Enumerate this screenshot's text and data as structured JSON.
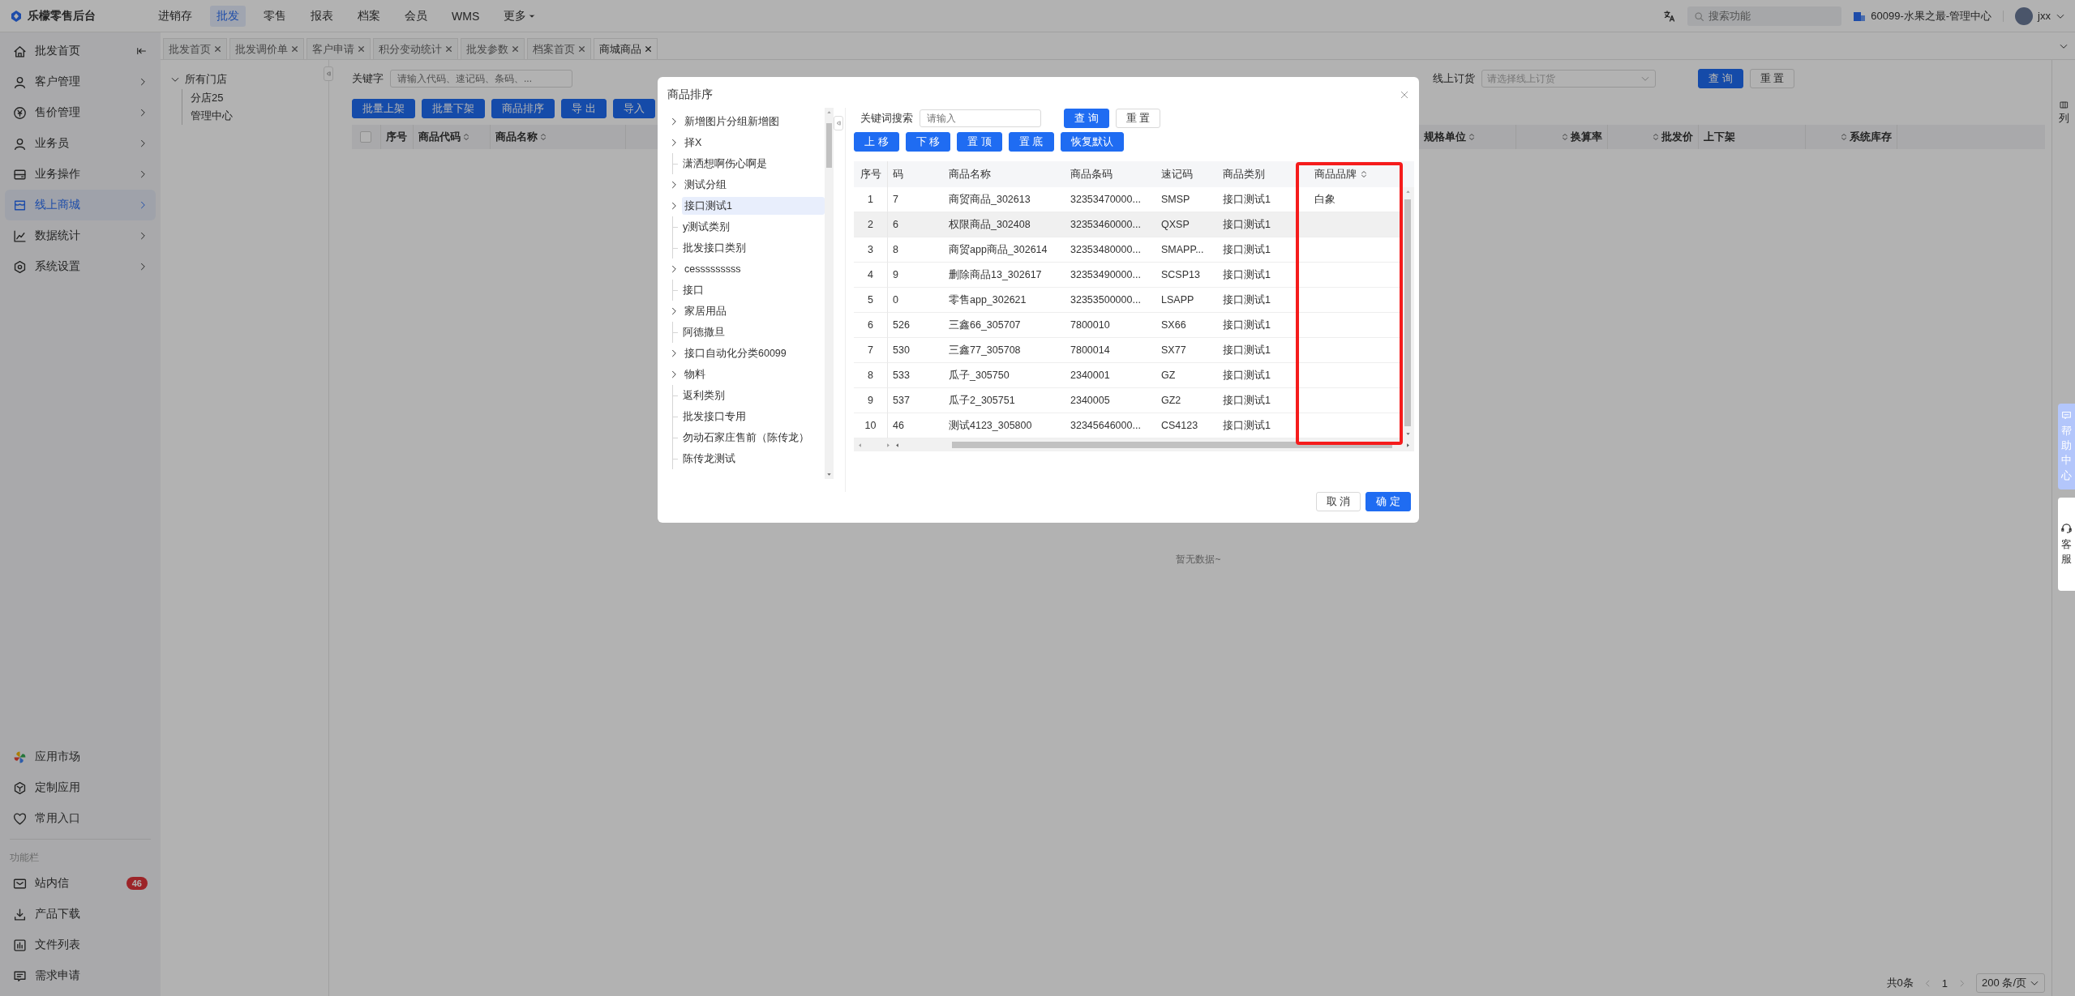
{
  "topbar": {
    "brand": "乐檬零售后台",
    "nav": [
      {
        "label": "进销存",
        "selected": false,
        "caret": false
      },
      {
        "label": "批发",
        "selected": true,
        "caret": false
      },
      {
        "label": "零售",
        "selected": false,
        "caret": false
      },
      {
        "label": "报表",
        "selected": false,
        "caret": false
      },
      {
        "label": "档案",
        "selected": false,
        "caret": false
      },
      {
        "label": "会员",
        "selected": false,
        "caret": false
      },
      {
        "label": "WMS",
        "selected": false,
        "caret": false
      },
      {
        "label": "更多",
        "selected": false,
        "caret": true
      }
    ],
    "search": {
      "placeholder": "搜索功能"
    },
    "store": "60099-水果之最-管理中心",
    "user": "jxx"
  },
  "sidebar": {
    "items": [
      {
        "label": "批发首页",
        "selected": false,
        "kind": "collapse"
      },
      {
        "label": "客户管理",
        "selected": false,
        "kind": "expand"
      },
      {
        "label": "售价管理",
        "selected": false,
        "kind": "expand"
      },
      {
        "label": "业务员",
        "selected": false,
        "kind": "expand"
      },
      {
        "label": "业务操作",
        "selected": false,
        "kind": "expand"
      },
      {
        "label": "线上商城",
        "selected": true,
        "kind": "expand"
      },
      {
        "label": "数据统计",
        "selected": false,
        "kind": "expand"
      },
      {
        "label": "系统设置",
        "selected": false,
        "kind": "expand"
      }
    ],
    "tools": [
      {
        "label": "应用市场"
      },
      {
        "label": "定制应用"
      },
      {
        "label": "常用入口"
      }
    ],
    "section": "功能栏",
    "functions": [
      {
        "label": "站内信",
        "badge": "46"
      },
      {
        "label": "产品下载"
      },
      {
        "label": "文件列表"
      },
      {
        "label": "需求申请"
      }
    ]
  },
  "tabs": [
    {
      "label": "批发首页",
      "selected": false
    },
    {
      "label": "批发调价单",
      "selected": false
    },
    {
      "label": "客户申请",
      "selected": false
    },
    {
      "label": "积分变动统计",
      "selected": false
    },
    {
      "label": "批发参数",
      "selected": false
    },
    {
      "label": "档案首页",
      "selected": false
    },
    {
      "label": "商城商品",
      "selected": true
    }
  ],
  "store_tree": {
    "label": "所有门店",
    "expanded": true,
    "children": [
      {
        "label": "分店25"
      },
      {
        "label": "管理中心"
      }
    ]
  },
  "filters": {
    "keyword": {
      "label": "关键字",
      "placeholder": "请输入代码、速记码、条码、..."
    },
    "order": {
      "label": "线上订货",
      "placeholder": "请选择线上订货"
    },
    "buttons": [
      {
        "label": "查 询",
        "kind": "primary"
      },
      {
        "label": "重 置",
        "kind": "default"
      }
    ]
  },
  "actions": [
    "批量上架",
    "批量下架",
    "商品排序",
    "导 出",
    "导入"
  ],
  "table": {
    "select_all_checked": false,
    "columns_left": [
      {
        "label": "序号",
        "sort_before": false,
        "sort_after": false
      },
      {
        "label": "商品代码",
        "sort_before": false,
        "sort_after": true
      },
      {
        "label": "商品名称",
        "sort_before": false,
        "sort_after": true
      }
    ],
    "columns_right": [
      {
        "label": "规格单位",
        "sort_before": false,
        "sort_after": true
      },
      {
        "label": "换算率",
        "sort_before": true,
        "sort_after": false
      },
      {
        "label": "批发价",
        "sort_before": true,
        "sort_after": false
      },
      {
        "label": "上下架",
        "sort_before": false,
        "sort_after": false
      },
      {
        "label": "系统库存",
        "sort_before": true,
        "sort_after": false
      }
    ],
    "column_settings": "列",
    "empty": "暂无数据~"
  },
  "pagination": {
    "total": "共0条",
    "page": "1",
    "page_size": "200 条/页"
  },
  "float_tabs": [
    {
      "label": "帮助中心",
      "kind": "help"
    },
    {
      "label": "客服",
      "kind": "service"
    }
  ],
  "dialog": {
    "title": "商品排序",
    "tree": [
      {
        "label": "新增图片分组新增图",
        "expandable": true,
        "selected": false
      },
      {
        "label": "择X",
        "expandable": true,
        "selected": false
      },
      {
        "label": "潇洒想啊伤心啊是",
        "expandable": false,
        "selected": false
      },
      {
        "label": "测试分组",
        "expandable": true,
        "selected": false
      },
      {
        "label": "接口测试1",
        "expandable": true,
        "selected": true
      },
      {
        "label": "y测试类别",
        "expandable": false,
        "selected": false
      },
      {
        "label": "批发接口类别",
        "expandable": false,
        "selected": false
      },
      {
        "label": "cesssssssss",
        "expandable": true,
        "selected": false
      },
      {
        "label": "接口",
        "expandable": false,
        "selected": false
      },
      {
        "label": "家居用品",
        "expandable": true,
        "selected": false
      },
      {
        "label": "阿德撒旦",
        "expandable": false,
        "selected": false
      },
      {
        "label": "接口自动化分类60099",
        "expandable": true,
        "selected": false
      },
      {
        "label": "物料",
        "expandable": true,
        "selected": false
      },
      {
        "label": "返利类别",
        "expandable": false,
        "selected": false
      },
      {
        "label": "批发接口专用",
        "expandable": false,
        "selected": false
      },
      {
        "label": "勿动石家庄售前（陈传龙）",
        "expandable": false,
        "selected": false
      },
      {
        "label": "陈传龙测试",
        "expandable": false,
        "selected": false
      }
    ],
    "search": {
      "label": "关键词搜索",
      "placeholder": "请输入"
    },
    "search_buttons": [
      {
        "label": "查 询",
        "kind": "primary"
      },
      {
        "label": "重 置",
        "kind": "default"
      }
    ],
    "move_buttons": [
      "上 移",
      "下 移",
      "置 顶",
      "置 底",
      "恢复默认"
    ],
    "columns": [
      {
        "label": "序号",
        "sort": false
      },
      {
        "label": "码",
        "sort": false
      },
      {
        "label": "商品名称",
        "sort": false
      },
      {
        "label": "商品条码",
        "sort": false
      },
      {
        "label": "速记码",
        "sort": false
      },
      {
        "label": "商品类别",
        "sort": false
      },
      {
        "label": "商品品牌",
        "sort": true
      }
    ],
    "rows": [
      {
        "highlighted": false,
        "cells": [
          "1",
          "7",
          "商贸商品_302613",
          "32353470000...",
          "SMSP",
          "接口测试1",
          "白象"
        ]
      },
      {
        "highlighted": true,
        "cells": [
          "2",
          "6",
          "权限商品_302408",
          "32353460000...",
          "QXSP",
          "接口测试1"
        ]
      },
      {
        "highlighted": false,
        "cells": [
          "3",
          "8",
          "商贸app商品_302614",
          "32353480000...",
          "SMAPP...",
          "接口测试1"
        ]
      },
      {
        "highlighted": false,
        "cells": [
          "4",
          "9",
          "删除商品13_302617",
          "32353490000...",
          "SCSP13",
          "接口测试1"
        ]
      },
      {
        "highlighted": false,
        "cells": [
          "5",
          "0",
          "零售app_302621",
          "32353500000...",
          "LSAPP",
          "接口测试1"
        ]
      },
      {
        "highlighted": false,
        "cells": [
          "6",
          "526",
          "三鑫66_305707",
          "7800010",
          "SX66",
          "接口测试1"
        ]
      },
      {
        "highlighted": false,
        "cells": [
          "7",
          "530",
          "三鑫77_305708",
          "7800014",
          "SX77",
          "接口测试1"
        ]
      },
      {
        "highlighted": false,
        "cells": [
          "8",
          "533",
          "瓜子_305750",
          "2340001",
          "GZ",
          "接口测试1"
        ]
      },
      {
        "highlighted": false,
        "cells": [
          "9",
          "537",
          "瓜子2_305751",
          "2340005",
          "GZ2",
          "接口测试1"
        ]
      },
      {
        "highlighted": false,
        "cells": [
          "10",
          "46",
          "测试4123_305800",
          "32345646000...",
          "CS4123",
          "接口测试1"
        ]
      }
    ],
    "footer": [
      {
        "label": "取 消",
        "kind": "default"
      },
      {
        "label": "确 定",
        "kind": "primary"
      }
    ]
  }
}
